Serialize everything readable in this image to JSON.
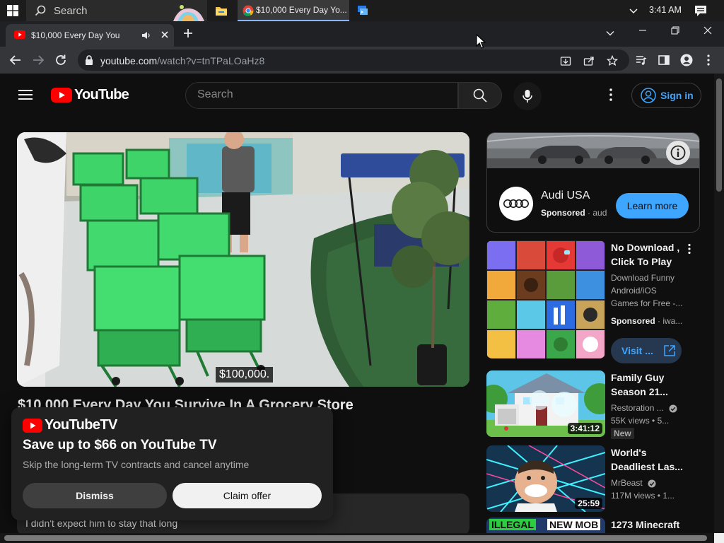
{
  "taskbar": {
    "search_label": "Search",
    "chrome_task_label": "$10,000 Every Day Yo...",
    "clock": "3:41 AM"
  },
  "browser": {
    "tab_title": "$10,000 Every Day You Survive In A Grocery Store",
    "url_host": "youtube.com",
    "url_path": "/watch?v=tnTPaLOaHz8"
  },
  "youtube": {
    "logo_text": "YouTube",
    "search_placeholder": "Search",
    "sign_in_label": "Sign in",
    "video": {
      "caption": "$100,000.",
      "title": "$10,000 Every Day You Survive In A Grocery Store",
      "description_snippet": "I didn't expect him to stay that long"
    },
    "promo": {
      "logo_text": "YouTubeTV",
      "headline": "Save up to $66 on YouTube TV",
      "subtext": "Skip the long-term TV contracts and cancel anytime",
      "dismiss_label": "Dismiss",
      "claim_label": "Claim offer"
    },
    "ad": {
      "advertiser": "Audi USA",
      "sponsored_label": "Sponsored",
      "domain": "aud",
      "cta": "Learn more"
    },
    "recommendations": [
      {
        "title": "No Download , Click To Play",
        "description": "Download Funny Android/iOS Games for Free -...",
        "sponsored_label": "Sponsored",
        "advertiser": "iwa...",
        "cta": "Visit ..."
      },
      {
        "title": "Family Guy Season 21...",
        "channel": "Restoration ...",
        "views": "55K views",
        "age": "5...",
        "duration": "3:41:12",
        "badge": "New"
      },
      {
        "title": "World's Deadliest Las...",
        "channel": "MrBeast",
        "views": "117M views",
        "age": "1...",
        "duration": "25:59"
      },
      {
        "title": "1273 Minecraft",
        "thumb_text_left": "ILLEGAL",
        "thumb_text_right": "NEW MOB"
      }
    ]
  },
  "colors": {
    "yt_red": "#ff0000",
    "link_blue": "#3ea6ff",
    "background": "#0f0f0f"
  },
  "icons": [
    "windows-logo-icon",
    "search-icon",
    "file-explorer-icon",
    "chrome-icon",
    "remote-desktop-icon",
    "chevron-up-icon",
    "notification-icon",
    "youtube-favicon-icon",
    "speaker-icon",
    "close-icon",
    "plus-icon",
    "chevron-down-icon",
    "minimize-icon",
    "restore-icon",
    "back-icon",
    "forward-icon",
    "reload-icon",
    "lock-icon",
    "install-icon",
    "share-icon",
    "star-icon",
    "media-control-icon",
    "side-panel-icon",
    "profile-icon",
    "kebab-menu-icon",
    "hamburger-menu-icon",
    "microphone-icon",
    "account-circle-icon",
    "info-icon",
    "audi-rings-icon",
    "external-link-icon",
    "verified-check-icon"
  ]
}
